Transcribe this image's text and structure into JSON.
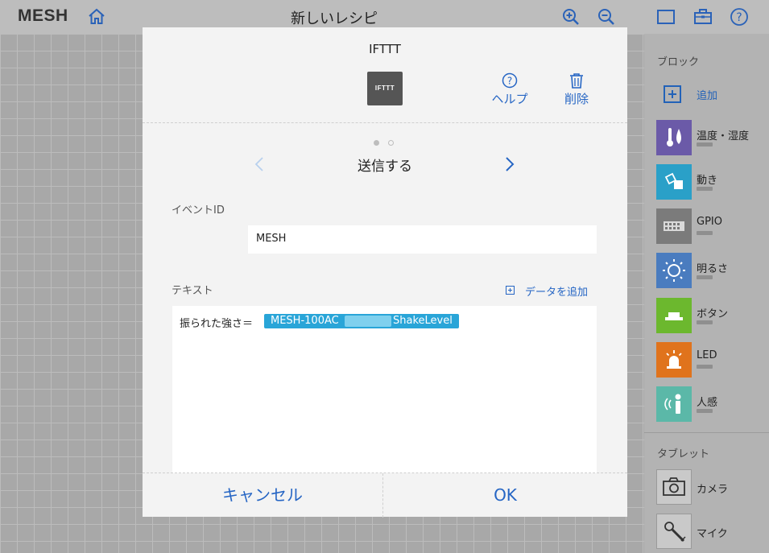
{
  "topbar": {
    "logo": "MESH",
    "title": "新しいレシピ",
    "icons": [
      "home-icon",
      "zoom-in-icon",
      "zoom-out-icon",
      "window-icon",
      "toolbox-icon",
      "help-icon"
    ]
  },
  "modal": {
    "title": "IFTTT",
    "logo_text": "IFTTT",
    "help_label": "ヘルプ",
    "delete_label": "削除",
    "page_index": 1,
    "page_count": 2,
    "action_name": "送信する",
    "event_label": "イベントID",
    "event_value": "MESH",
    "text_label": "テキスト",
    "add_data_label": "データを追加",
    "text_prefix": "振られた強さ＝",
    "chip_device": "MESH-100AC",
    "chip_field": "ShakeLevel",
    "cancel_label": "キャンセル",
    "ok_label": "OK"
  },
  "sidebar": {
    "blocks_title": "ブロック",
    "add_label": "追加",
    "blocks": [
      {
        "label": "温度・湿度",
        "color": "#6b5aa8",
        "icon": "thermometer-icon"
      },
      {
        "label": "動き",
        "color": "#2aa0c8",
        "icon": "motion-icon"
      },
      {
        "label": "GPIO",
        "color": "#7b7b7b",
        "icon": "gpio-icon"
      },
      {
        "label": "明るさ",
        "color": "#4a7cbf",
        "icon": "brightness-icon"
      },
      {
        "label": "ボタン",
        "color": "#6cb82e",
        "icon": "button-icon"
      },
      {
        "label": "LED",
        "color": "#e0731c",
        "icon": "led-icon"
      },
      {
        "label": "人感",
        "color": "#5bb8a8",
        "icon": "person-icon"
      }
    ],
    "tablet_title": "タブレット",
    "tablet": [
      {
        "label": "カメラ",
        "icon": "camera-icon"
      },
      {
        "label": "マイク",
        "icon": "microphone-icon"
      }
    ]
  }
}
